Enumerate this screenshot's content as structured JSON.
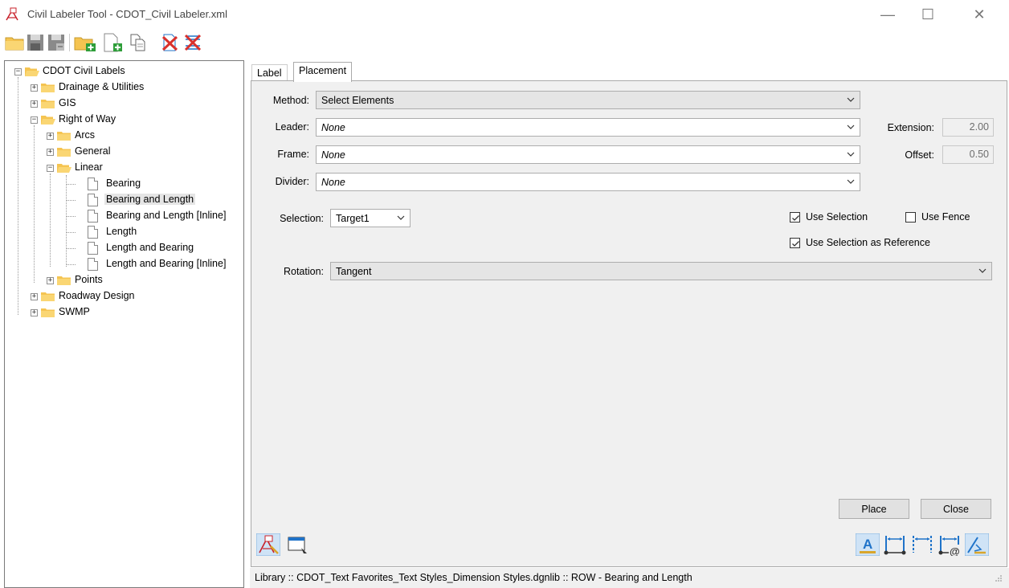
{
  "window": {
    "title": "Civil Labeler Tool - CDOT_Civil Labeler.xml",
    "minimize_glyph": "—",
    "maximize_glyph": "☐",
    "close_glyph": "✕"
  },
  "toolbar": {
    "buttons": [
      "open-folder-icon",
      "save-icon",
      "save-as-icon",
      "new-folder-icon",
      "new-label-icon",
      "copy-icon",
      "delete-icon",
      "delete-all-icon"
    ]
  },
  "tree": {
    "root": "CDOT Civil Labels",
    "drainage": "Drainage & Utilities",
    "gis": "GIS",
    "row": "Right of Way",
    "arcs": "Arcs",
    "general": "General",
    "linear": "Linear",
    "bearing": "Bearing",
    "bearing_length": "Bearing and Length",
    "bearing_length_inline": "Bearing and Length [Inline]",
    "length": "Length",
    "length_bearing": "Length and Bearing",
    "length_bearing_inline": "Length and Bearing [Inline]",
    "points": "Points",
    "roadway": "Roadway Design",
    "swmp": "SWMP"
  },
  "tabs": {
    "label": "Label",
    "placement": "Placement"
  },
  "placement": {
    "method_label": "Method:",
    "method_value": "Select Elements",
    "leader_label": "Leader:",
    "leader_value": "None",
    "frame_label": "Frame:",
    "frame_value": "None",
    "divider_label": "Divider:",
    "divider_value": "None",
    "extension_label": "Extension:",
    "extension_value": "2.00",
    "offset_label": "Offset:",
    "offset_value": "0.50",
    "selection_label": "Selection:",
    "selection_value": "Target1",
    "use_selection": "Use Selection",
    "use_selection_checked": true,
    "use_fence": "Use Fence",
    "use_fence_checked": false,
    "use_selection_ref": "Use Selection as Reference",
    "use_selection_ref_checked": true,
    "rotation_label": "Rotation:",
    "rotation_value": "Tangent",
    "place_button": "Place",
    "close_button": "Close"
  },
  "status": {
    "text": "Library :: CDOT_Text Favorites_Text Styles_Dimension Styles.dgnlib :: ROW - Bearing and Length"
  },
  "colors": {
    "folder": "#f5c451",
    "accent_blue": "#1f73c9",
    "delete_red": "#d9302c",
    "app_red": "#c8202a"
  }
}
